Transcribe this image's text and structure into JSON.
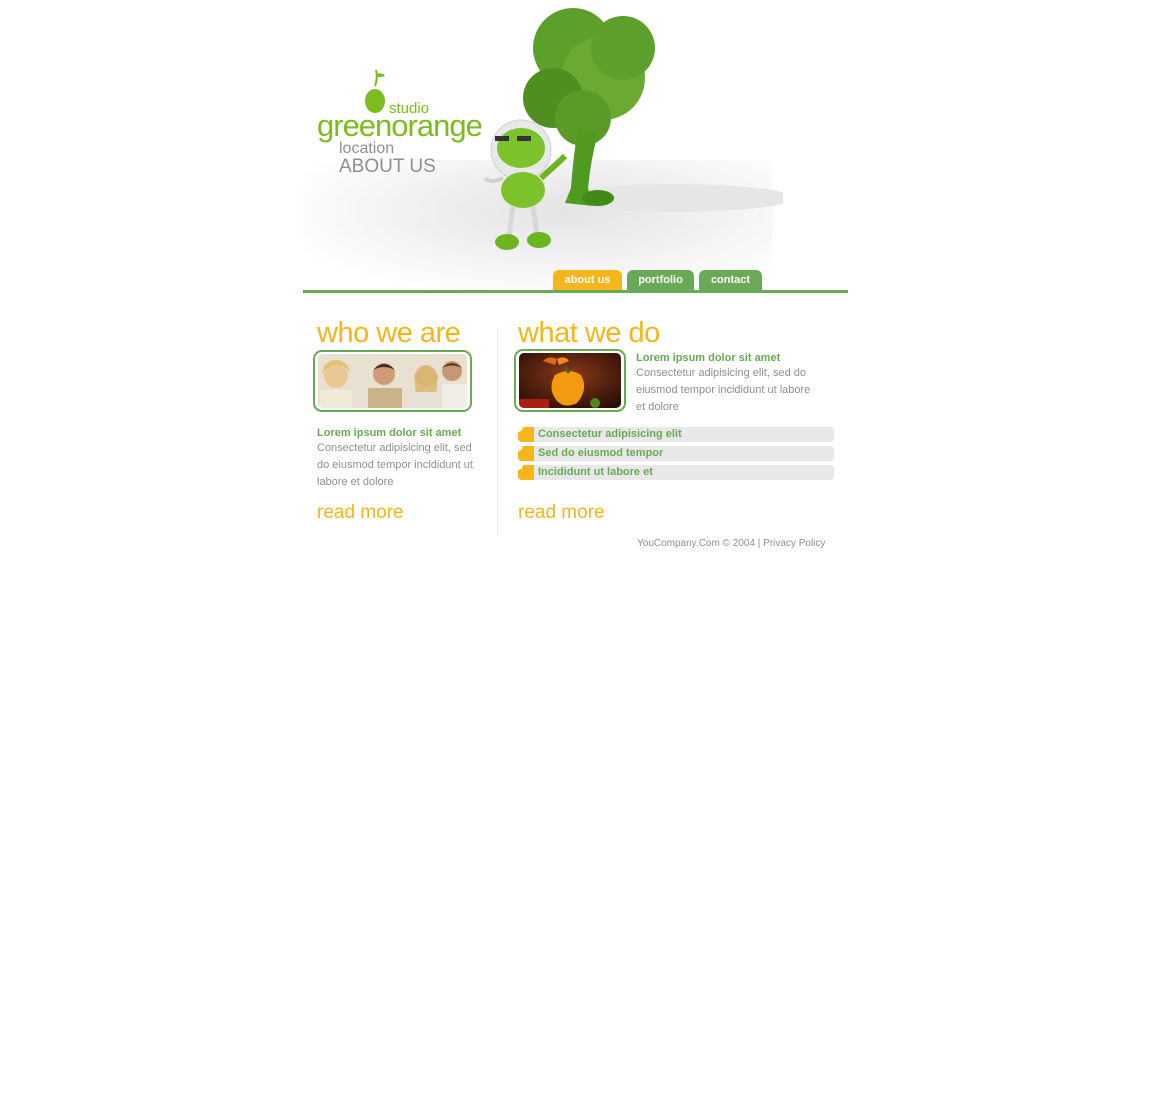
{
  "header": {
    "logo": {
      "word_green": "green",
      "word_orange": "orange",
      "studio": "studio"
    },
    "location_label": "location",
    "page_name": "ABOUT US"
  },
  "nav": {
    "tabs": [
      {
        "label": "about us",
        "active": true
      },
      {
        "label": "portfolio",
        "active": false
      },
      {
        "label": "contact",
        "active": false
      }
    ]
  },
  "who_we_are": {
    "title": "who we are",
    "heading": "Lorem ipsum dolor sit amet",
    "body": "Consectetur adipisicing elit, sed do eiusmod tempor incididunt ut labore et dolore",
    "read_more": "read more"
  },
  "what_we_do": {
    "title": "what we do",
    "heading": "Lorem ipsum dolor sit amet",
    "body": "Consectetur adipisicing elit, sed do eiusmod tempor incididunt ut labore et dolore",
    "list": [
      "Consectetur adipisicing elit",
      "Sed do eiusmod tempor",
      "Incididunt ut labore et"
    ],
    "read_more": "read more"
  },
  "footer": {
    "copyright": "YouCompany.Com © 2004 |",
    "privacy": "Privacy Policy"
  },
  "colors": {
    "green": "#6aa955",
    "orange": "#f7b51c",
    "grey_text": "#8f8f8f"
  }
}
